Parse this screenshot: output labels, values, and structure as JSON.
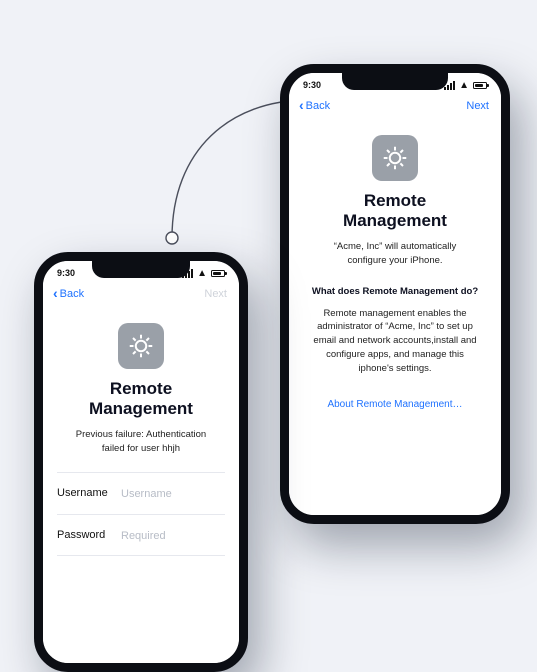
{
  "statusbar": {
    "time": "9:30"
  },
  "nav": {
    "back": "Back",
    "next": "Next"
  },
  "icon": "gear-icon",
  "phone_a": {
    "title": "Remote Management",
    "error": "Previous failure: Authentication failed for user hhjh",
    "next_enabled": false,
    "form": {
      "username_label": "Username",
      "username_placeholder": "Username",
      "username_value": "",
      "password_label": "Password",
      "password_placeholder": "Required",
      "password_value": ""
    }
  },
  "phone_b": {
    "title": "Remote Management",
    "subtitle": "“Acme, Inc” will automatically configure your iPhone.",
    "section_heading": "What does Remote Management do?",
    "body": "Remote management enables the administrator of “Acme, Inc” to set up email and network accounts,install and configure apps, and manage this iphone's settings.",
    "link": "About Remote Management…",
    "next_enabled": true
  }
}
